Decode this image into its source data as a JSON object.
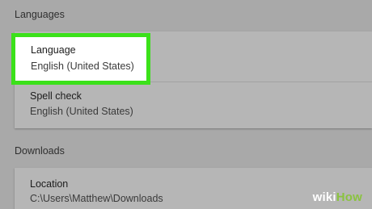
{
  "languages_section": {
    "title": "Languages",
    "language_row": {
      "label": "Language",
      "value": "English (United States)"
    },
    "spellcheck_row": {
      "label": "Spell check",
      "value": "English (United States)"
    }
  },
  "downloads_section": {
    "title": "Downloads",
    "location_row": {
      "label": "Location",
      "value": "C:\\Users\\Matthew\\Downloads"
    }
  },
  "watermark": {
    "part1": "wiki",
    "part2": "How"
  },
  "colors": {
    "highlight_border": "#3be11a",
    "background": "#a9a9a9",
    "card": "#b6b6b6"
  }
}
